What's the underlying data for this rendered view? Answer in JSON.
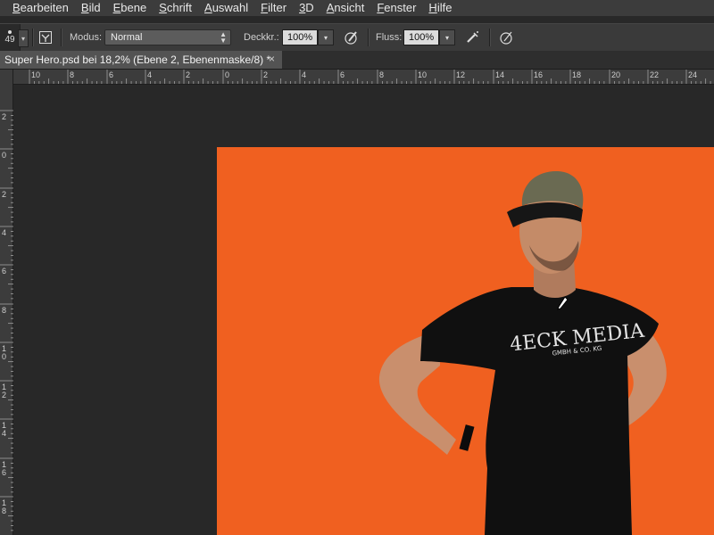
{
  "menu": [
    {
      "id": "bearbeiten",
      "acc": "B",
      "rest": "earbeiten"
    },
    {
      "id": "bild",
      "acc": "B",
      "rest": "ild"
    },
    {
      "id": "ebene",
      "acc": "E",
      "rest": "bene"
    },
    {
      "id": "schrift",
      "acc": "S",
      "rest": "chrift"
    },
    {
      "id": "auswahl",
      "acc": "A",
      "rest": "uswahl"
    },
    {
      "id": "filter",
      "acc": "F",
      "rest": "ilter"
    },
    {
      "id": "3d",
      "acc": "3",
      "rest": "D"
    },
    {
      "id": "ansicht",
      "acc": "A",
      "rest": "nsicht"
    },
    {
      "id": "fenster",
      "acc": "F",
      "rest": "enster"
    },
    {
      "id": "hilfe",
      "acc": "H",
      "rest": "ilfe"
    }
  ],
  "options": {
    "brush_size": "49",
    "mode_label": "Modus:",
    "mode_value": "Normal",
    "opacity_label": "Deckkr.:",
    "opacity_value": "100%",
    "flow_label": "Fluss:",
    "flow_value": "100%"
  },
  "document_tab": {
    "title": "Super Hero.psd bei 18,2% (Ebene 2, Ebenenmaske/8) *",
    "close": "×"
  },
  "ruler_top_labels": [
    "10",
    "8",
    "6",
    "4",
    "2",
    "0",
    "2",
    "4",
    "6",
    "8",
    "10",
    "12",
    "14",
    "16",
    "18",
    "20",
    "22",
    "24"
  ],
  "ruler_left_labels": [
    "2",
    "0",
    "2",
    "4",
    "6",
    "8",
    "10",
    "12",
    "14",
    "16",
    "18"
  ],
  "canvas": {
    "document_color": "#f06020",
    "tshirt_text": "4ECK MEDIA",
    "tshirt_subtext": "GMBH & CO. KG"
  },
  "colors": {
    "menubar": "#3c3c3c",
    "options": "#3a3a3a",
    "canvas_bg": "#282828"
  }
}
